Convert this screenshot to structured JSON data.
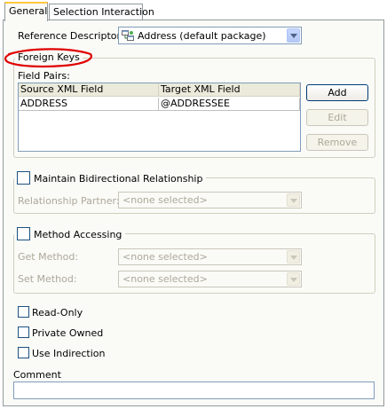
{
  "tabs": [
    {
      "label": "General",
      "active": true
    },
    {
      "label": "Selection Interaction",
      "active": false
    }
  ],
  "reference_descriptor": {
    "label": "Reference Descriptor:",
    "value": "Address (default package)",
    "icon": "descriptor-class-icon"
  },
  "foreign_keys": {
    "title": "Foreign Keys",
    "field_pairs_label": "Field Pairs:",
    "columns": [
      "Source XML Field",
      "Target XML Field"
    ],
    "rows": [
      {
        "source": "ADDRESS",
        "target": "@ADDRESSEE"
      }
    ],
    "buttons": {
      "add": "Add",
      "edit": "Edit",
      "remove": "Remove"
    }
  },
  "bidirectional": {
    "label": "Maintain Bidirectional Relationship",
    "checked": false,
    "partner_label": "Relationship Partner:",
    "partner_value": "<none selected>"
  },
  "method_accessing": {
    "label": "Method Accessing",
    "checked": false,
    "get_label": "Get Method:",
    "get_value": "<none selected>",
    "set_label": "Set Method:",
    "set_value": "<none selected>"
  },
  "options": {
    "read_only": "Read-Only",
    "private_owned": "Private Owned",
    "use_indirection": "Use Indirection"
  },
  "comment": {
    "label": "Comment",
    "value": ""
  },
  "annotation_color": "#e00000"
}
